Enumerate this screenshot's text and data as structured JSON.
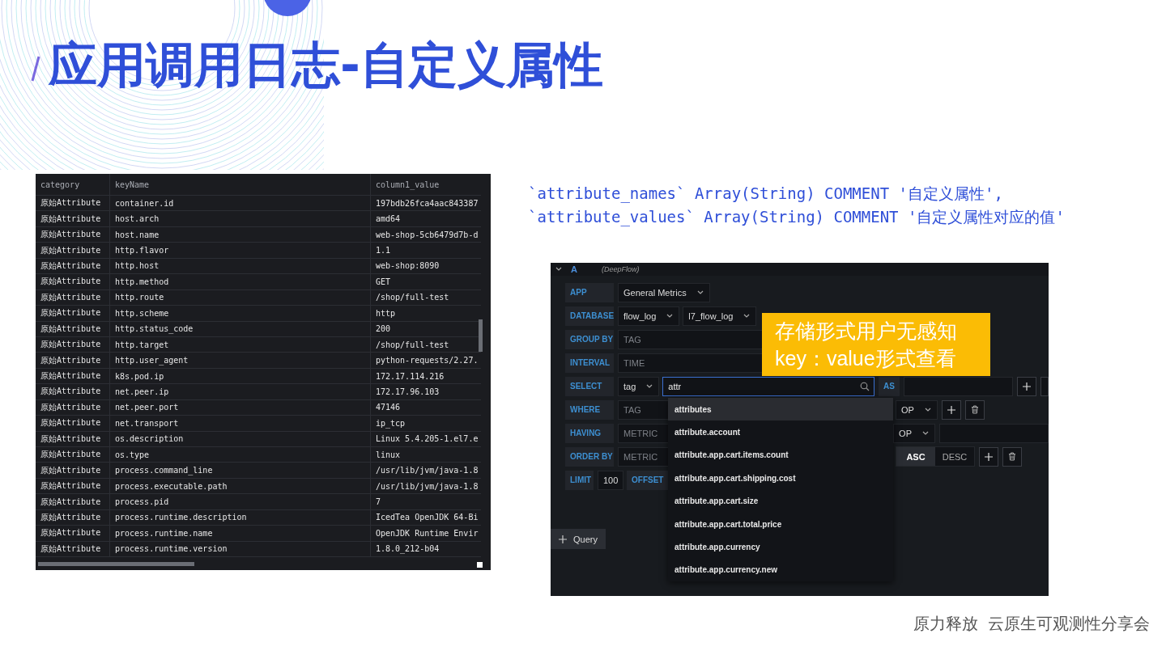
{
  "title": "应用调用日志-自定义属性",
  "code_lines": [
    "`attribute_names` Array(String) COMMENT '自定义属性',",
    "`attribute_values` Array(String) COMMENT '自定义属性对应的值'"
  ],
  "table": {
    "columns": [
      "category",
      "keyName",
      "column1_value"
    ],
    "rows": [
      [
        "原始Attribute",
        "container.id",
        "197bdb26fca4aac843387"
      ],
      [
        "原始Attribute",
        "host.arch",
        "amd64"
      ],
      [
        "原始Attribute",
        "host.name",
        "web-shop-5cb6479d7b-d"
      ],
      [
        "原始Attribute",
        "http.flavor",
        "1.1"
      ],
      [
        "原始Attribute",
        "http.host",
        "web-shop:8090"
      ],
      [
        "原始Attribute",
        "http.method",
        "GET"
      ],
      [
        "原始Attribute",
        "http.route",
        "/shop/full-test"
      ],
      [
        "原始Attribute",
        "http.scheme",
        "http"
      ],
      [
        "原始Attribute",
        "http.status_code",
        "200"
      ],
      [
        "原始Attribute",
        "http.target",
        "/shop/full-test"
      ],
      [
        "原始Attribute",
        "http.user_agent",
        "python-requests/2.27."
      ],
      [
        "原始Attribute",
        "k8s.pod.ip",
        "172.17.114.216"
      ],
      [
        "原始Attribute",
        "net.peer.ip",
        "172.17.96.103"
      ],
      [
        "原始Attribute",
        "net.peer.port",
        "47146"
      ],
      [
        "原始Attribute",
        "net.transport",
        "ip_tcp"
      ],
      [
        "原始Attribute",
        "os.description",
        "Linux 5.4.205-1.el7.e"
      ],
      [
        "原始Attribute",
        "os.type",
        "linux"
      ],
      [
        "原始Attribute",
        "process.command_line",
        "/usr/lib/jvm/java-1.8"
      ],
      [
        "原始Attribute",
        "process.executable.path",
        "/usr/lib/jvm/java-1.8"
      ],
      [
        "原始Attribute",
        "process.pid",
        "7"
      ],
      [
        "原始Attribute",
        "process.runtime.description",
        "IcedTea OpenJDK 64-Bi"
      ],
      [
        "原始Attribute",
        "process.runtime.name",
        "OpenJDK Runtime Envir"
      ],
      [
        "原始Attribute",
        "process.runtime.version",
        "1.8.0_212-b04"
      ]
    ]
  },
  "query": {
    "name": "A",
    "source": "(DeepFlow)",
    "expanded": true,
    "rows": [
      {
        "label": "APP",
        "main": [
          {
            "kind": "select",
            "text": "General Metrics"
          }
        ],
        "side": []
      },
      {
        "label": "DATABASE",
        "main": [
          {
            "kind": "select",
            "text": "flow_log"
          },
          {
            "kind": "select",
            "text": "l7_flow_log"
          }
        ],
        "side": []
      },
      {
        "label": "GROUP BY",
        "main": [
          {
            "kind": "placeholder",
            "placeholder": "TAG"
          }
        ],
        "side": []
      },
      {
        "label": "INTERVAL",
        "main": [
          {
            "kind": "placeholder",
            "placeholder": "TIME"
          }
        ],
        "side": []
      },
      {
        "label": "SELECT",
        "main": [
          {
            "kind": "select",
            "text": "tag"
          },
          {
            "kind": "search",
            "text": "attr"
          }
        ],
        "side": [
          {
            "kind": "tag",
            "text": "AS"
          },
          {
            "kind": "input"
          },
          {
            "kind": "add"
          },
          {
            "kind": "stub"
          }
        ]
      },
      {
        "label": "WHERE",
        "main": [
          {
            "kind": "placeholder",
            "placeholder": "TAG"
          }
        ],
        "side": [
          {
            "kind": "select",
            "text": "OP"
          },
          {
            "kind": "add"
          },
          {
            "kind": "delete"
          }
        ]
      },
      {
        "label": "HAVING",
        "main": [
          {
            "kind": "placeholder",
            "placeholder": "METRIC"
          }
        ],
        "side": [
          {
            "kind": "select",
            "text": "OP"
          },
          {
            "kind": "input"
          }
        ]
      },
      {
        "label": "ORDER BY",
        "main": [
          {
            "kind": "placeholder",
            "placeholder": "METRIC"
          }
        ],
        "side": [
          {
            "kind": "toggle",
            "options": [
              {
                "label": "ASC",
                "selected": true
              },
              {
                "label": "DESC",
                "selected": false
              }
            ]
          },
          {
            "kind": "add"
          },
          {
            "kind": "delete"
          }
        ]
      },
      {
        "label": "LIMIT",
        "main": [
          {
            "kind": "value",
            "text": "100"
          },
          {
            "kind": "tag",
            "text": "OFFSET"
          }
        ],
        "side": []
      }
    ],
    "add_query": "Query"
  },
  "dropdown": [
    {
      "label": "attributes",
      "selected": true
    },
    {
      "label": "attribute.account",
      "selected": false
    },
    {
      "label": "attribute.app.cart.items.count",
      "selected": false
    },
    {
      "label": "attribute.app.cart.shipping.cost",
      "selected": false
    },
    {
      "label": "attribute.app.cart.size",
      "selected": false
    },
    {
      "label": "attribute.app.cart.total.price",
      "selected": false
    },
    {
      "label": "attribute.app.currency",
      "selected": false
    },
    {
      "label": "attribute.app.currency.new",
      "selected": false
    }
  ],
  "callout": [
    "存储形式用户无感知",
    "key：value形式查看"
  ],
  "footer": [
    "原力释放",
    "云原生可观测性分享会"
  ]
}
